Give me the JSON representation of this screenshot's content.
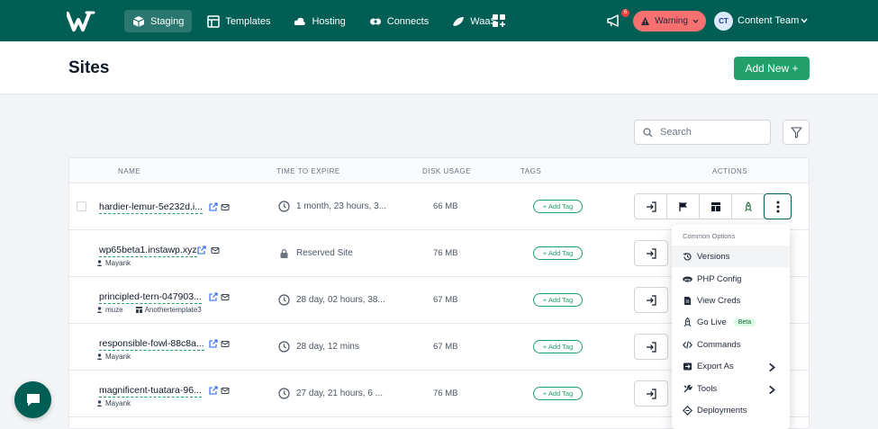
{
  "topbar": {
    "nav": [
      {
        "label": "Staging",
        "icon": "cube-icon",
        "active": true
      },
      {
        "label": "Templates",
        "icon": "templates-icon",
        "active": false
      },
      {
        "label": "Hosting",
        "icon": "cloud-icon",
        "active": false
      },
      {
        "label": "Connects",
        "icon": "connects-icon",
        "active": false
      },
      {
        "label": "WaaS",
        "icon": "waas-icon",
        "active": false
      }
    ],
    "notification_count": "6",
    "warning_label": "Warning",
    "avatar_initials": "CT",
    "team_name": "Content Team"
  },
  "header": {
    "title": "Sites",
    "add_new_label": "Add New +"
  },
  "search": {
    "placeholder": "Search"
  },
  "table": {
    "columns": {
      "name": "NAME",
      "expire": "TIME TO EXPIRE",
      "disk": "DISK USAGE",
      "tags": "TAGS",
      "actions": "ACTIONS"
    },
    "add_tag_label": "+ Add Tag",
    "rows": [
      {
        "name": "hardier-lemur-5e232d.i...",
        "expire": "1 month, 23 hours, 3...",
        "disk": "66 MB",
        "user": "",
        "template": ""
      },
      {
        "name": "wp65beta1.instawp.xyz",
        "expire": "Reserved Site",
        "disk": "76 MB",
        "user": "Mayank",
        "template": ""
      },
      {
        "name": "principled-tern-047903...",
        "expire": "28 day, 02 hours, 38...",
        "disk": "67 MB",
        "user": "muze",
        "template": "Anothertemplate3"
      },
      {
        "name": "responsible-fowl-88c8a...",
        "expire": "28 day, 12 mins",
        "disk": "67 MB",
        "user": "Mayank",
        "template": ""
      },
      {
        "name": "magnificent-tuatara-96...",
        "expire": "27 day, 21 hours, 6 ...",
        "disk": "76 MB",
        "user": "Mayank",
        "template": ""
      }
    ]
  },
  "dropdown": {
    "header": "Common Options",
    "items": [
      {
        "label": "Versions",
        "icon": "history-icon"
      },
      {
        "label": "PHP Config",
        "icon": "php-icon"
      },
      {
        "label": "View Creds",
        "icon": "document-icon"
      },
      {
        "label": "Go Live",
        "icon": "rocket-icon",
        "badge": "Beta"
      },
      {
        "label": "Commands",
        "icon": "code-icon"
      },
      {
        "label": "Export As",
        "icon": "export-icon"
      },
      {
        "label": "Tools",
        "icon": "tools-icon"
      },
      {
        "label": "Deployments",
        "icon": "deployments-icon"
      }
    ]
  },
  "colors": {
    "brand": "#005e54",
    "accent": "#22a06b",
    "warning": "#f87171"
  }
}
